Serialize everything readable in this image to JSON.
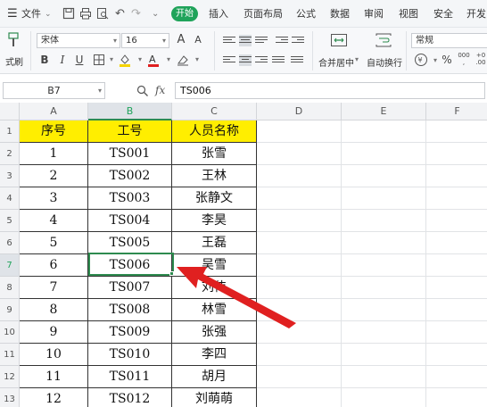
{
  "menubar": {
    "menu_label": "文件",
    "tabs": [
      "开始",
      "插入",
      "页面布局",
      "公式",
      "数据",
      "审阅",
      "视图",
      "安全",
      "开发"
    ],
    "colors": {
      "start_tab_bg": "#1fa35a",
      "selection": "#2e8b4f",
      "header_fill": "#ffee00",
      "arrow": "#e02020"
    }
  },
  "ribbon": {
    "format_painter": "式刷",
    "font_name": "宋体",
    "font_size": "16",
    "bold": "B",
    "italic": "I",
    "underline": "U",
    "merge_center": "合并居中",
    "wrap_text": "自动换行",
    "number_format": "常规",
    "percent": "%"
  },
  "formula_bar": {
    "cell_ref": "B7",
    "fx": "fx",
    "value": "TS006"
  },
  "sheet": {
    "columns": [
      "A",
      "B",
      "C",
      "D",
      "E",
      "F"
    ],
    "active_column": "B",
    "active_row": "7",
    "row_numbers": [
      "1",
      "2",
      "3",
      "4",
      "5",
      "6",
      "7",
      "8",
      "9",
      "10",
      "11",
      "12",
      "13"
    ],
    "header": [
      "序号",
      "工号",
      "人员名称"
    ],
    "rows": [
      [
        "1",
        "TS001",
        "张雪"
      ],
      [
        "2",
        "TS002",
        "王林"
      ],
      [
        "3",
        "TS003",
        "张静文"
      ],
      [
        "4",
        "TS004",
        "李昊"
      ],
      [
        "5",
        "TS005",
        "王磊"
      ],
      [
        "6",
        "TS006",
        "吴雪"
      ],
      [
        "7",
        "TS007",
        "刘伟"
      ],
      [
        "8",
        "TS008",
        "林雪"
      ],
      [
        "9",
        "TS009",
        "张强"
      ],
      [
        "10",
        "TS010",
        "李四"
      ],
      [
        "11",
        "TS011",
        "胡月"
      ],
      [
        "12",
        "TS012",
        "刘萌萌"
      ]
    ]
  }
}
